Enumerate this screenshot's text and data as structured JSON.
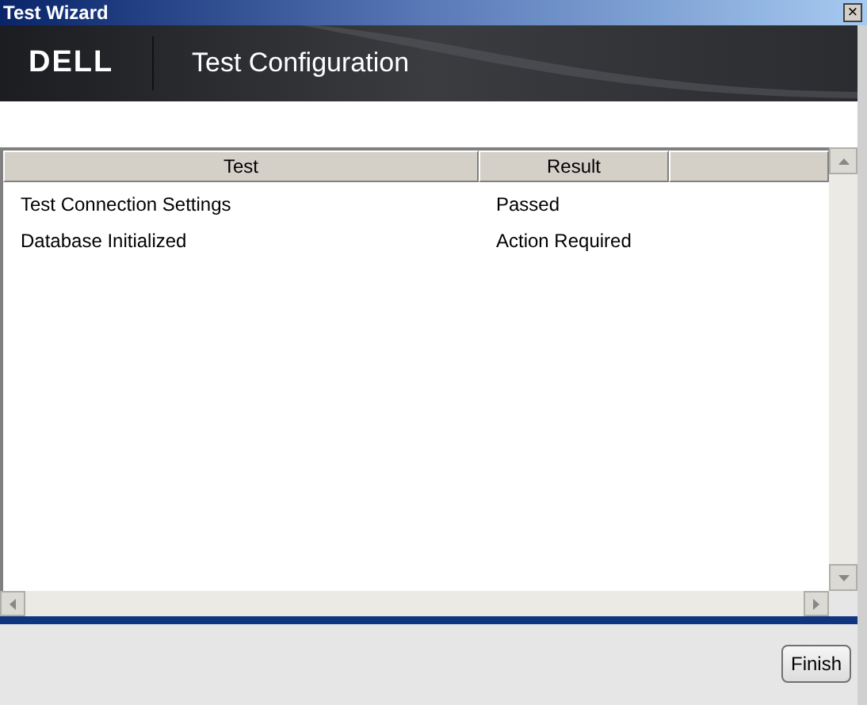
{
  "window": {
    "title": "Test Wizard",
    "close": "×"
  },
  "banner": {
    "logo": "DELL",
    "title": "Test Configuration"
  },
  "table": {
    "columns": [
      "Test",
      "Result"
    ],
    "rows": [
      {
        "test": "Test Connection Settings",
        "result": "Passed"
      },
      {
        "test": "Database Initialized",
        "result": "Action Required"
      }
    ]
  },
  "buttons": [
    "Finish"
  ]
}
